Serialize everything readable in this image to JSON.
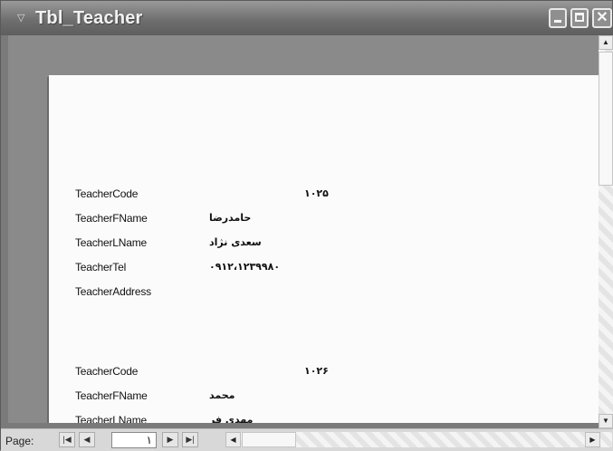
{
  "window": {
    "title": "Tbl_Teacher",
    "icon": "form-icon",
    "buttons": {
      "minimize": "minimize-icon",
      "maximize": "maximize-icon",
      "close": "✕"
    }
  },
  "records": [
    {
      "fields": [
        {
          "label": "TeacherCode",
          "value": "۱۰۲۵"
        },
        {
          "label": "TeacherFName",
          "value": "حامدرضا"
        },
        {
          "label": "TeacherLName",
          "value": "سعدی نژاد"
        },
        {
          "label": "TeacherTel",
          "value": "۰۹۱۲،۱۲۳۹۹۸۰"
        },
        {
          "label": "TeacherAddress",
          "value": ""
        }
      ]
    },
    {
      "fields": [
        {
          "label": "TeacherCode",
          "value": "۱۰۲۶"
        },
        {
          "label": "TeacherFName",
          "value": "محمد"
        },
        {
          "label": "TeacherLName",
          "value": "مهدی فر"
        }
      ]
    }
  ],
  "statusbar": {
    "page_label": "Page:",
    "page_value": "۱",
    "nav": {
      "first": "|◀",
      "prev": "◀",
      "next": "▶",
      "last": "▶|"
    }
  }
}
